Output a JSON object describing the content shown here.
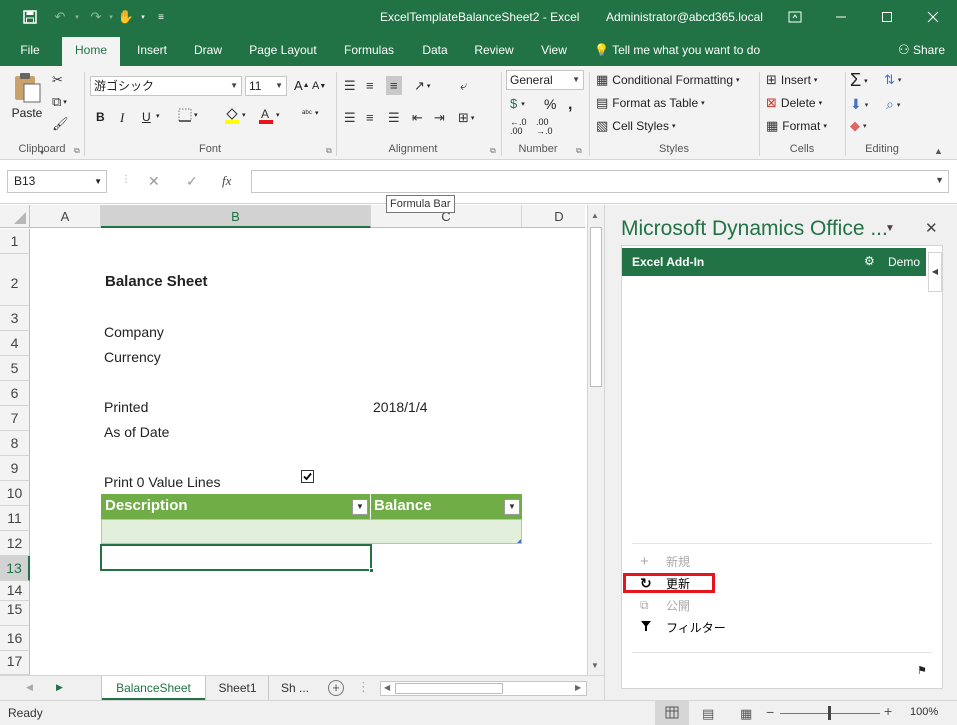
{
  "window": {
    "title": "ExcelTemplateBalanceSheet2  -  Excel",
    "account": "Administrator@abcd365.local"
  },
  "ribbon": {
    "tabs": [
      "File",
      "Home",
      "Insert",
      "Draw",
      "Page Layout",
      "Formulas",
      "Data",
      "Review",
      "View"
    ],
    "tell_me": "Tell me what you want to do",
    "share": "Share",
    "clipboard": {
      "label": "Clipboard",
      "paste": "Paste"
    },
    "font": {
      "label": "Font",
      "name": "游ゴシック",
      "size": "11",
      "bold": "B",
      "italic": "I",
      "underline": "U"
    },
    "alignment": {
      "label": "Alignment"
    },
    "number": {
      "label": "Number",
      "format": "General"
    },
    "styles": {
      "label": "Styles",
      "conditional": "Conditional Formatting",
      "format_table": "Format as Table",
      "cell_styles": "Cell Styles"
    },
    "cells": {
      "label": "Cells",
      "insert": "Insert",
      "delete": "Delete",
      "format": "Format"
    },
    "editing": {
      "label": "Editing"
    }
  },
  "formula_bar": {
    "name_box": "B13",
    "fx": "fx",
    "value": "",
    "tooltip": "Formula Bar"
  },
  "sheet": {
    "columns": [
      "A",
      "B",
      "C",
      "D"
    ],
    "rows": [
      "1",
      "2",
      "3",
      "4",
      "5",
      "6",
      "7",
      "8",
      "9",
      "10",
      "11",
      "12",
      "13",
      "14",
      "15",
      "16",
      "17"
    ],
    "title": "Balance Sheet",
    "company_label": "Company",
    "currency_label": "Currency",
    "printed_label": "Printed",
    "printed_value": "2018/1/4",
    "as_of_label": "As of Date",
    "print_zero_label": "Print 0 Value Lines",
    "print_zero_checked": true,
    "table": {
      "headers": [
        "Description",
        "Balance"
      ],
      "header_color": "#70ad47",
      "row_color": "#e2efda"
    },
    "selected_cell": "B13"
  },
  "sheet_tabs": {
    "tabs": [
      "BalanceSheet",
      "Sheet1",
      "Sh ..."
    ],
    "active": "BalanceSheet"
  },
  "task_pane": {
    "title": "Microsoft Dynamics Office ...",
    "header": "Excel Add-In",
    "header_right": "Demo",
    "actions": [
      {
        "label": "新規",
        "enabled": false
      },
      {
        "label": "更新",
        "enabled": true,
        "highlighted": true
      },
      {
        "label": "公開",
        "enabled": false
      },
      {
        "label": "フィルター",
        "enabled": true
      }
    ]
  },
  "status_bar": {
    "status": "Ready",
    "zoom": "100%"
  },
  "colors": {
    "excel_green": "#217346",
    "highlight_red": "#e8141c"
  }
}
